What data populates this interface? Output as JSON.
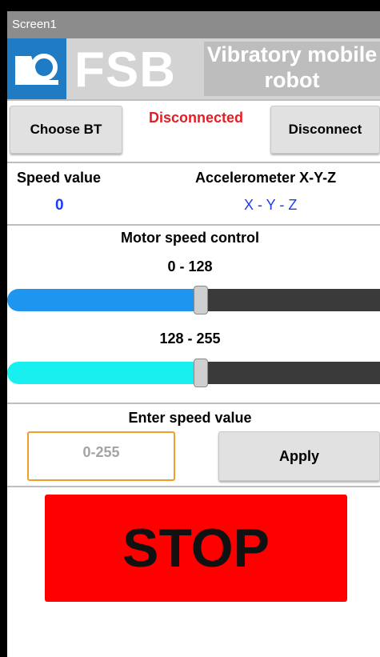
{
  "titlebar": {
    "title": "Screen1"
  },
  "banner": {
    "logo_text": "FSB",
    "title_line1": "Vibratory mobile",
    "title_line2": "robot"
  },
  "bluetooth": {
    "choose_label": "Choose BT",
    "status": "Disconnected",
    "disconnect_label": "Disconnect"
  },
  "readouts": {
    "speed_label": "Speed value",
    "speed_value": "0",
    "accel_label": "Accelerometer X-Y-Z",
    "accel_value": "X - Y - Z"
  },
  "motor": {
    "title": "Motor speed control",
    "slider1": {
      "label": "0 - 128",
      "fraction": 0.52,
      "color": "#1e96f0"
    },
    "slider2": {
      "label": "128 - 255",
      "fraction": 0.52,
      "color": "#18f0f0"
    }
  },
  "speed_entry": {
    "title": "Enter speed value",
    "placeholder": "0-255",
    "apply_label": "Apply"
  },
  "stop": {
    "label": "STOP",
    "color": "#ff0000"
  }
}
